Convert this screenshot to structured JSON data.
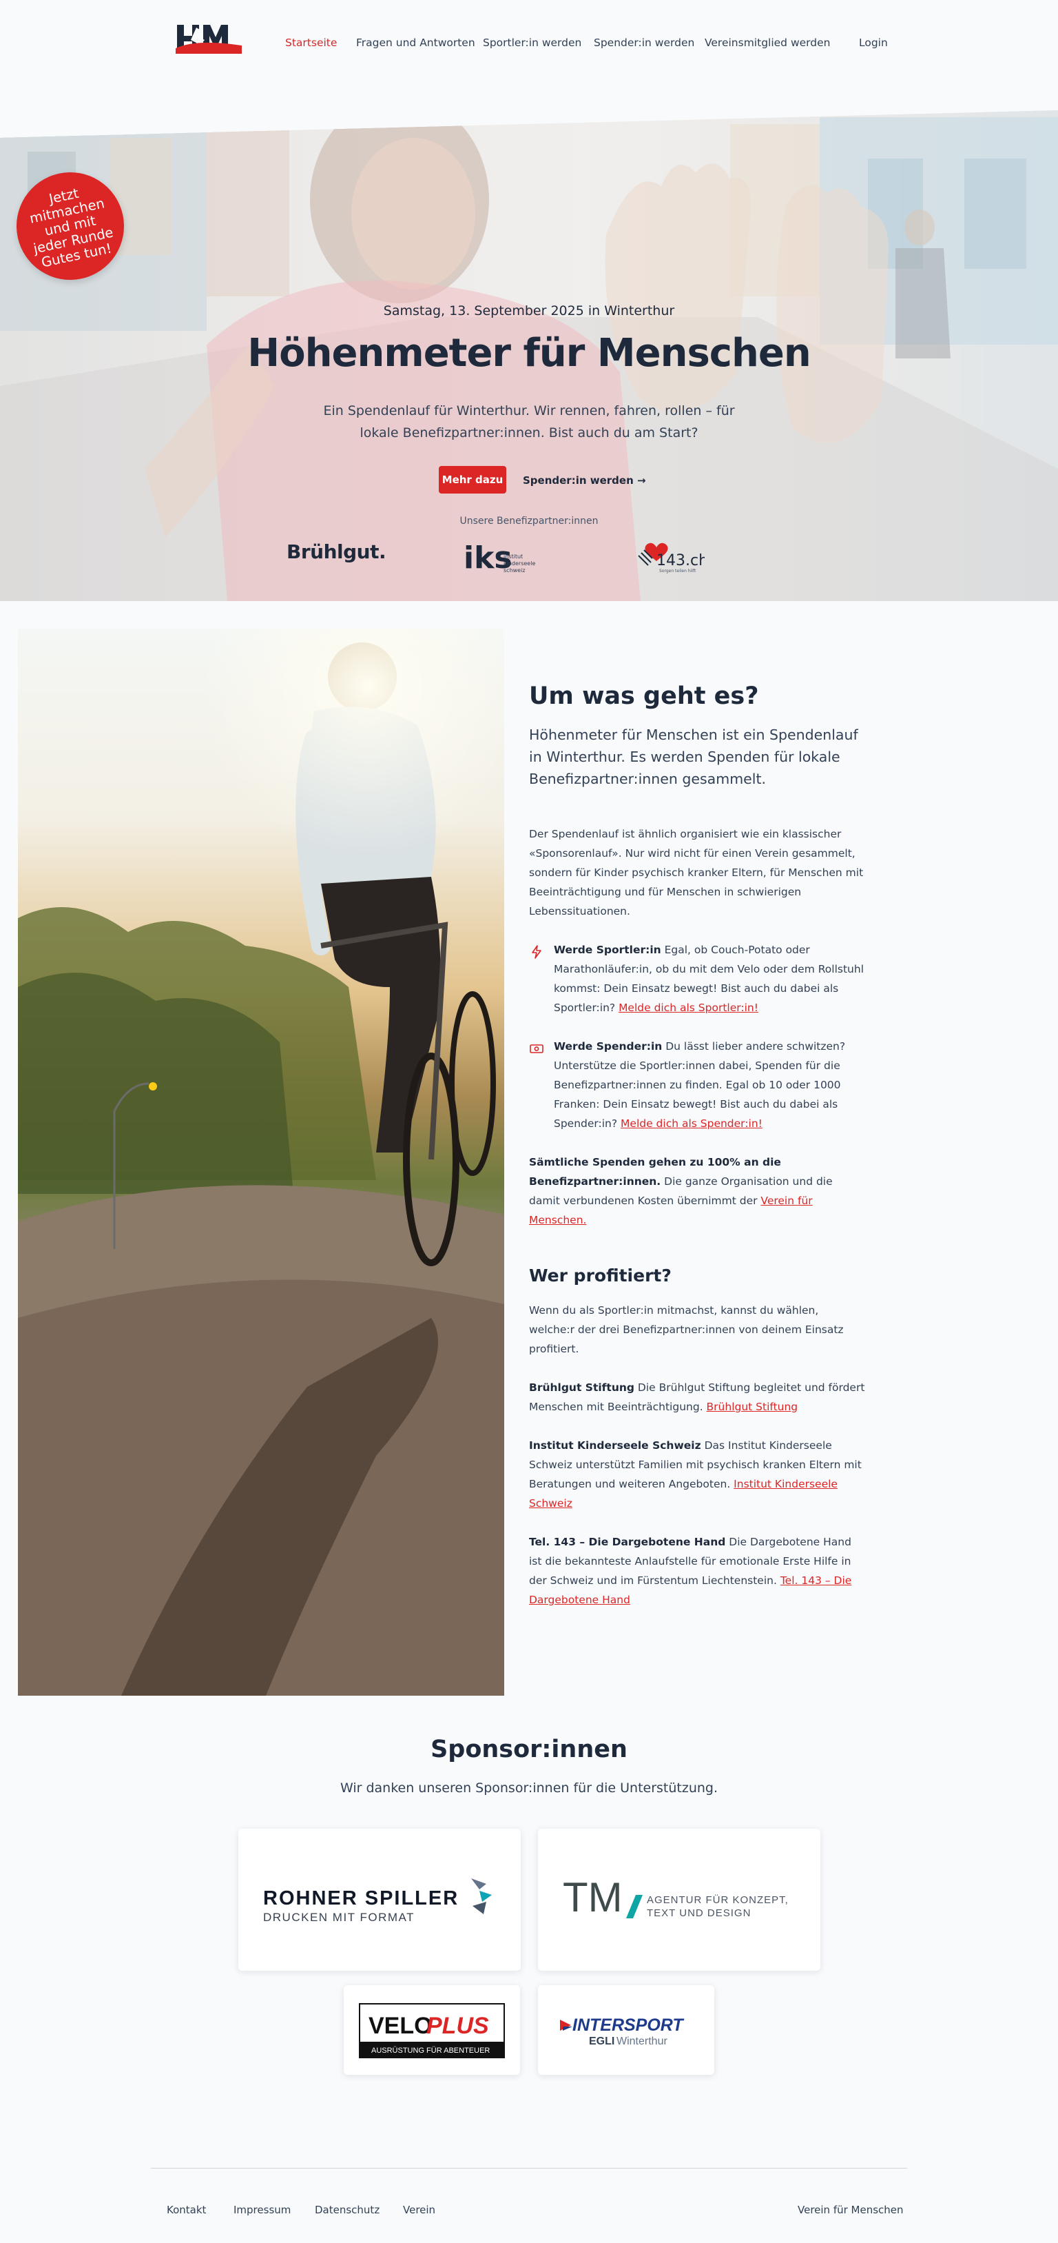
{
  "header": {
    "logo_alt": "HfM",
    "nav": [
      "Startseite",
      "Fragen und Antworten",
      "Sportler:in werden",
      "Spender:in werden",
      "Vereinsmitglied werden"
    ],
    "login": "Login",
    "accent_color": "#dc2626"
  },
  "hero": {
    "badge": "Jetzt mitmachen und mit jeder Runde Gutes tun!",
    "date": "Samstag, 13. September 2025 in Winterthur",
    "title": "Höhenmeter für Menschen",
    "lead": "Ein Spendenlauf für Winterthur. Wir rennen, fahren, rollen – für lokale Benefizpartner:innen. Bist auch du am Start?",
    "primary_button": "Mehr dazu",
    "secondary_button": "Spender:in werden →",
    "partners_label": "Unsere Benefizpartner:innen",
    "partner_logos": {
      "bruehlgut": "Brühlgut.",
      "iks_mark": "iks",
      "iks_text": [
        "institut",
        "kinderseele",
        "schweiz"
      ],
      "tel143": "143.ch",
      "tel143_sub": "Sorgen teilen hilft"
    }
  },
  "about": {
    "title": "Um was geht es?",
    "lead": "Höhenmeter für Menschen ist ein Spendenlauf in Winterthur. Es werden Spenden für lokale Benefizpartner:innen gesammelt.",
    "intro": "Der Spendenlauf ist ähnlich organisiert wie ein klassischer «Sponsorenlauf». Nur wird nicht für einen Verein gesammelt, sondern für Kinder psychisch kranker Eltern, für Menschen mit Beeinträchtigung und für Menschen in schwierigen Lebenssituationen.",
    "features": [
      {
        "icon": "lightning-icon",
        "title": "Werde Sportler:in",
        "text": " Egal, ob Couch-Potato oder Marathonläufer:in, ob du mit dem Velo oder dem Rollstuhl kommst: Dein Einsatz bewegt! Bist auch du dabei als Sportler:in? ",
        "link": "Melde dich als Sportler:in!"
      },
      {
        "icon": "money-icon",
        "title": "Werde Spender:in",
        "text": " Du lässt lieber andere schwitzen? Unterstütze die Sportler:innen dabei, Spenden für die Benefizpartner:innen zu finden. Egal ob 10 oder 1000 Franken: Dein Einsatz bewegt! Bist auch du dabei als Spender:in? ",
        "link": "Melde dich als Spender:in!"
      }
    ],
    "note_bold": "Sämtliche Spenden gehen zu 100% an die Benefizpartner:innen.",
    "note_text": " Die ganze Organisation und die damit verbundenen Kosten übernimmt der ",
    "note_link": "Verein für Menschen.",
    "who_title": "Wer profitiert?",
    "who_intro": "Wenn du als Sportler:in mitmachst, kannst du wählen, welche:r der drei Benefizpartner:innen von deinem Einsatz profitiert.",
    "beneficiaries": [
      {
        "name": "Brühlgut Stiftung",
        "text": " Die Brühlgut Stiftung begleitet und fördert Menschen mit Beeinträchtigung. ",
        "link": "Brühlgut Stiftung"
      },
      {
        "name": "Institut Kinderseele Schweiz",
        "text": " Das Institut Kinderseele Schweiz unterstützt Familien mit psychisch kranken Eltern mit Beratungen und weiteren Angeboten. ",
        "link": "Institut Kinderseele Schweiz"
      },
      {
        "name": "Tel. 143 – Die Dargebotene Hand",
        "text": " Die Dargebotene Hand ist die bekannteste Anlaufstelle für emotionale Erste Hilfe in der Schweiz und im Fürstentum Liechtenstein. ",
        "link": "Tel. 143 – Die Dargebotene Hand"
      }
    ]
  },
  "sponsors": {
    "title": "Sponsor:innen",
    "subtitle": "Wir danken unseren Sponsor:innen für die Unterstützung.",
    "rohner_name": "ROHNER SPILLER",
    "rohner_sub": "DRUCKEN MIT FORMAT",
    "tm_mark": "TM",
    "tm_sub": [
      "AGENTUR FÜR KONZEPT,",
      "TEXT UND DESIGN"
    ],
    "veloplus_a": "VELO",
    "veloplus_b": "PLUS",
    "veloplus_sub": "AUSRÜSTUNG FÜR ABENTEUER",
    "intersport": "INTERSPORT",
    "intersport_sub_a": "EGLI",
    "intersport_sub_b": "Winterthur"
  },
  "footer": {
    "links": [
      "Kontakt",
      "Impressum",
      "Datenschutz",
      "Verein"
    ],
    "right": "Verein für Menschen"
  }
}
